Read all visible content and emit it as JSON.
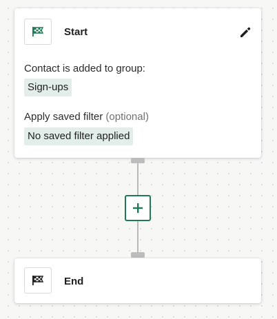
{
  "start_node": {
    "title": "Start",
    "icon": "checkered-flag-icon",
    "icon_color": "#1e7a55",
    "trigger_label": "Contact is added to group:",
    "group_value": "Sign-ups",
    "filter_label": "Apply saved filter",
    "filter_optional": "(optional)",
    "filter_value": "No saved filter applied"
  },
  "connector": {
    "add_icon": "plus-icon",
    "accent_color": "#1e7a55"
  },
  "end_node": {
    "title": "End",
    "icon": "checkered-flag-icon",
    "icon_color": "#1f1f1f"
  }
}
